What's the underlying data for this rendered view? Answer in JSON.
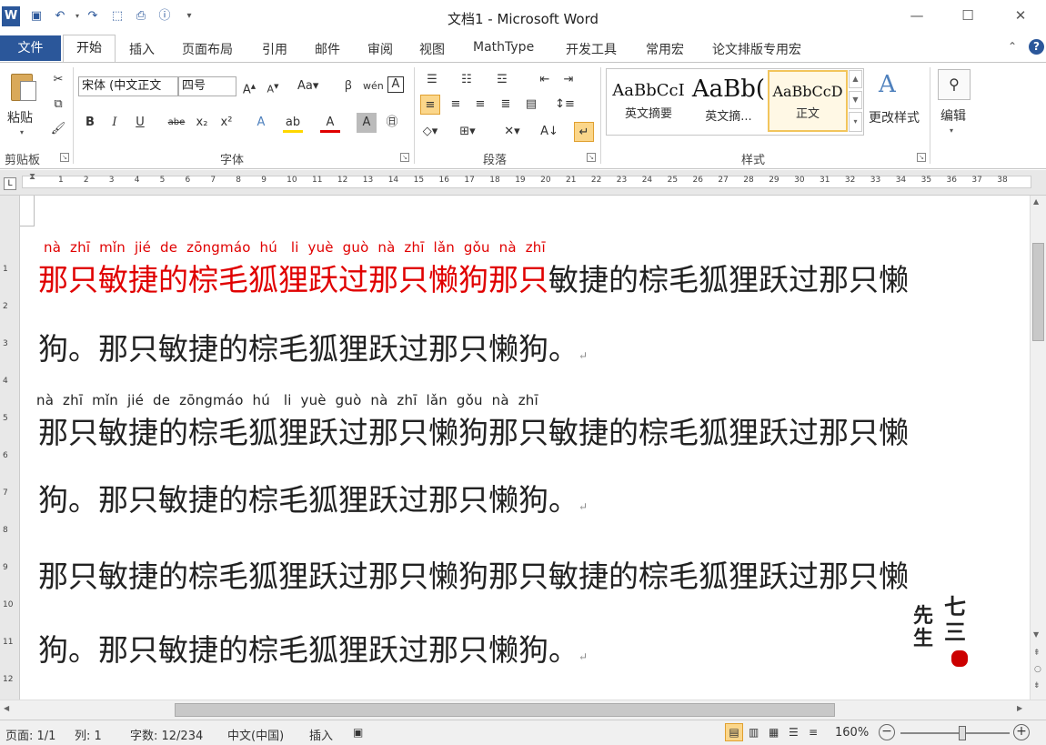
{
  "window": {
    "title": "文档1 - Microsoft Word"
  },
  "tabs": [
    "文件",
    "开始",
    "插入",
    "页面布局",
    "引用",
    "邮件",
    "审阅",
    "视图",
    "MathType",
    "开发工具",
    "常用宏",
    "论文排版专用宏"
  ],
  "ribbon": {
    "clipboard": {
      "paste_label": "粘贴",
      "group_label": "剪贴板"
    },
    "font": {
      "font_name": "宋体 (中文正文",
      "font_size": "四号",
      "group_label": "字体"
    },
    "paragraph": {
      "group_label": "段落"
    },
    "styles": {
      "group_label": "样式",
      "items": [
        {
          "sample": "AaBbCcI",
          "name": "英文摘要"
        },
        {
          "sample": "AaBb(",
          "name": "英文摘..."
        },
        {
          "sample": "AaBbCcD",
          "name": "正文"
        }
      ],
      "change_styles_label": "更改样式"
    },
    "editing": {
      "label": "编辑"
    }
  },
  "ruler": {
    "h_ticks": [
      "1",
      "2",
      "4",
      "6",
      "8",
      "10",
      "12",
      "14",
      "16",
      "18",
      "20",
      "22",
      "24",
      "26",
      "28",
      "30",
      "32",
      "34",
      "36",
      "38"
    ],
    "h_ticks_odd": [
      "3",
      "5",
      "7",
      "9",
      "11",
      "13",
      "15",
      "17",
      "19",
      "21",
      "23",
      "25",
      "27",
      "29",
      "31",
      "33",
      "35",
      "37"
    ],
    "v_ticks": [
      "1",
      "2",
      "3",
      "4",
      "5",
      "6",
      "7",
      "8",
      "9",
      "10",
      "11",
      "12"
    ]
  },
  "document": {
    "para1": {
      "pinyin": "nà  zhī  mǐn  jié  de  zōngmáo  hú   li  yuè  guò  nà  zhī  lǎn  gǒu  nà  zhī",
      "red_text": "那只敏捷的棕毛狐狸跃过那只懒狗那只",
      "black_text": "敏捷的棕毛狐狸跃过那只懒",
      "line2": "狗。那只敏捷的棕毛狐狸跃过那只懒狗。"
    },
    "para2": {
      "pinyin": "nà  zhī  mǐn  jié  de  zōngmáo  hú   li  yuè  guò  nà  zhī  lǎn  gǒu  nà  zhī",
      "line1": "那只敏捷的棕毛狐狸跃过那只懒狗那只敏捷的棕毛狐狸跃过那只懒",
      "line2": "狗。那只敏捷的棕毛狐狸跃过那只懒狗。"
    },
    "para3": {
      "line1": "那只敏捷的棕毛狐狸跃过那只懒狗那只敏捷的棕毛狐狸跃过那只懒",
      "line2": "狗。那只敏捷的棕毛狐狸跃过那只懒狗。"
    },
    "paragraph_mark": "↵"
  },
  "watermark": {
    "text_right": "七三",
    "text_left": "先生"
  },
  "status": {
    "page": "页面: 1/1",
    "column": "列: 1",
    "word_count": "字数: 12/234",
    "language": "中文(中国)",
    "mode": "插入",
    "zoom": "160%"
  },
  "colors": {
    "accent": "#2b579a",
    "red_text": "#e00000"
  }
}
